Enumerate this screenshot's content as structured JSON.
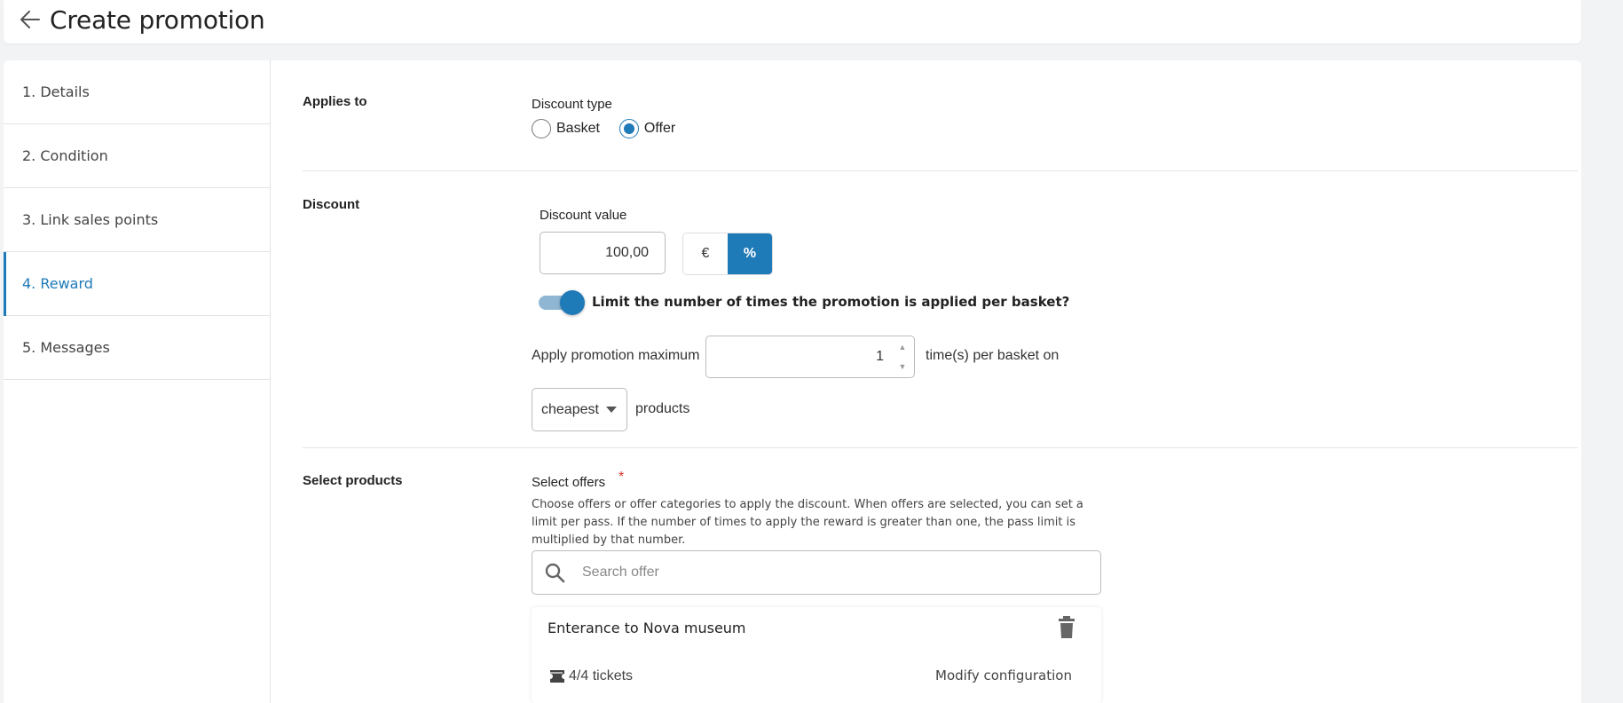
{
  "header": {
    "title": "Create promotion"
  },
  "sidebar": {
    "items": [
      {
        "label": "1. Details"
      },
      {
        "label": "2. Condition"
      },
      {
        "label": "3. Link sales points"
      },
      {
        "label": "4. Reward"
      },
      {
        "label": "5. Messages"
      }
    ],
    "active_index": 3
  },
  "applies_to": {
    "section_label": "Applies to",
    "discount_type_label": "Discount type",
    "options": [
      "Basket",
      "Offer"
    ],
    "selected": "Offer"
  },
  "discount": {
    "section_label": "Discount",
    "value_label": "Discount value",
    "value": "100,00",
    "units": [
      "€",
      "%"
    ],
    "selected_unit": "%",
    "limit_toggle_label": "Limit the number of times the promotion is applied per basket?",
    "limit_toggle_on": true,
    "apply_max_label": "Apply promotion maximum",
    "apply_max_value": "1",
    "per_basket_label": "time(s) per basket on",
    "product_selector_value": "cheapest",
    "products_label": "products"
  },
  "select_products": {
    "section_label": "Select products",
    "offers_label": "Select offers",
    "required_mark": "*",
    "help_text": "Choose offers or offer categories to apply the discount. When offers are selected, you can set a limit per pass. If the number of times to apply the reward is greater than one, the pass limit is multiplied by that number.",
    "search_placeholder": "Search offer",
    "offers": [
      {
        "title": "Enterance to Nova museum",
        "tickets": "4/4 tickets",
        "modify_label": "Modify configuration"
      }
    ]
  },
  "colors": {
    "accent": "#1f7ab8",
    "required": "#d9342b"
  }
}
